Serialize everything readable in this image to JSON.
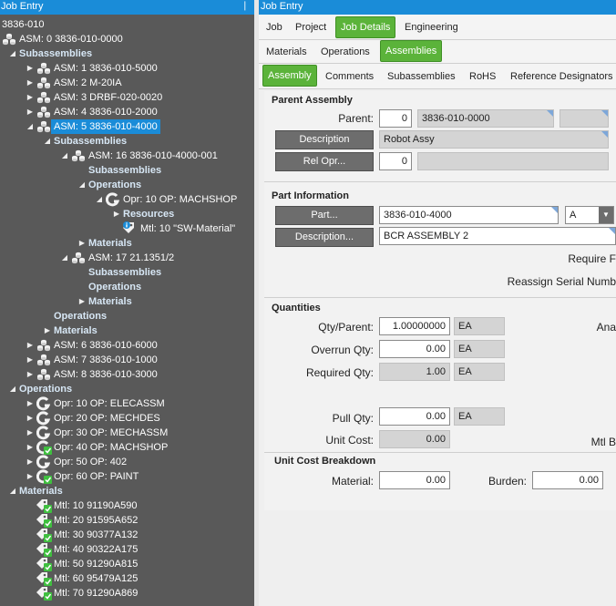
{
  "tree": {
    "title": "Job Entry",
    "pin_icon": "pin-icon",
    "rows": [
      {
        "text": "3836-010",
        "indent": 0,
        "arrow": "",
        "icon": "",
        "bold": false
      },
      {
        "text": "ASM: 0 3836-010-0000",
        "indent": 0,
        "arrow": "",
        "icon": "asm",
        "bold": false
      },
      {
        "text": "Subassemblies",
        "indent": 1,
        "arrow": "open",
        "icon": "",
        "bold": true
      },
      {
        "text": "ASM: 1 3836-010-5000",
        "indent": 2,
        "arrow": "closed",
        "icon": "asm",
        "bold": false
      },
      {
        "text": "ASM: 2 M-20IA",
        "indent": 2,
        "arrow": "closed",
        "icon": "asm",
        "bold": false
      },
      {
        "text": "ASM: 3 DRBF-020-0020",
        "indent": 2,
        "arrow": "closed",
        "icon": "asm",
        "bold": false
      },
      {
        "text": "ASM: 4 3836-010-2000",
        "indent": 2,
        "arrow": "closed",
        "icon": "asm",
        "bold": false
      },
      {
        "text": "ASM: 5 3836-010-4000",
        "indent": 2,
        "arrow": "open",
        "icon": "asm",
        "bold": false,
        "selected": true
      },
      {
        "text": "Subassemblies",
        "indent": 3,
        "arrow": "open",
        "icon": "",
        "bold": true
      },
      {
        "text": "ASM: 16 3836-010-4000-001",
        "indent": 4,
        "arrow": "open",
        "icon": "asm",
        "bold": false
      },
      {
        "text": "Subassemblies",
        "indent": 5,
        "arrow": "",
        "icon": "",
        "bold": true
      },
      {
        "text": "Operations",
        "indent": 5,
        "arrow": "open",
        "icon": "",
        "bold": true
      },
      {
        "text": "Opr: 10 OP: MACHSHOP",
        "indent": 6,
        "arrow": "open",
        "icon": "opr",
        "bold": false
      },
      {
        "text": "Resources",
        "indent": 7,
        "arrow": "closed",
        "icon": "",
        "bold": true
      },
      {
        "text": "Mtl: 10 \"SW-Material\"",
        "indent": 7,
        "arrow": "",
        "icon": "mtl-info",
        "bold": false
      },
      {
        "text": "Materials",
        "indent": 5,
        "arrow": "closed",
        "icon": "",
        "bold": true
      },
      {
        "text": "ASM: 17 21.1351/2",
        "indent": 4,
        "arrow": "open",
        "icon": "asm",
        "bold": false
      },
      {
        "text": "Subassemblies",
        "indent": 5,
        "arrow": "",
        "icon": "",
        "bold": true
      },
      {
        "text": "Operations",
        "indent": 5,
        "arrow": "",
        "icon": "",
        "bold": true
      },
      {
        "text": "Materials",
        "indent": 5,
        "arrow": "closed",
        "icon": "",
        "bold": true
      },
      {
        "text": "Operations",
        "indent": 3,
        "arrow": "",
        "icon": "",
        "bold": true
      },
      {
        "text": "Materials",
        "indent": 3,
        "arrow": "closed",
        "icon": "",
        "bold": true
      },
      {
        "text": "ASM: 6 3836-010-6000",
        "indent": 2,
        "arrow": "closed",
        "icon": "asm",
        "bold": false
      },
      {
        "text": "ASM: 7 3836-010-1000",
        "indent": 2,
        "arrow": "closed",
        "icon": "asm",
        "bold": false
      },
      {
        "text": "ASM: 8 3836-010-3000",
        "indent": 2,
        "arrow": "closed",
        "icon": "asm",
        "bold": false
      },
      {
        "text": "Operations",
        "indent": 1,
        "arrow": "open",
        "icon": "",
        "bold": true
      },
      {
        "text": "Opr: 10 OP: ELECASSM",
        "indent": 2,
        "arrow": "closed",
        "icon": "opr",
        "bold": false
      },
      {
        "text": "Opr: 20 OP: MECHDES",
        "indent": 2,
        "arrow": "closed",
        "icon": "opr",
        "bold": false
      },
      {
        "text": "Opr: 30 OP: MECHASSM",
        "indent": 2,
        "arrow": "closed",
        "icon": "opr",
        "bold": false
      },
      {
        "text": "Opr: 40 OP: MACHSHOP",
        "indent": 2,
        "arrow": "closed",
        "icon": "opr-check",
        "bold": false
      },
      {
        "text": "Opr: 50 OP: 402",
        "indent": 2,
        "arrow": "closed",
        "icon": "opr",
        "bold": false
      },
      {
        "text": "Opr: 60 OP: PAINT",
        "indent": 2,
        "arrow": "closed",
        "icon": "opr-check",
        "bold": false
      },
      {
        "text": "Materials",
        "indent": 1,
        "arrow": "open",
        "icon": "",
        "bold": true
      },
      {
        "text": "Mtl: 10 91190A590",
        "indent": 2,
        "arrow": "",
        "icon": "mtl-check",
        "bold": false
      },
      {
        "text": "Mtl: 20 91595A652",
        "indent": 2,
        "arrow": "",
        "icon": "mtl-check",
        "bold": false
      },
      {
        "text": "Mtl: 30 90377A132",
        "indent": 2,
        "arrow": "",
        "icon": "mtl-check",
        "bold": false
      },
      {
        "text": "Mtl: 40 90322A175",
        "indent": 2,
        "arrow": "",
        "icon": "mtl-check",
        "bold": false
      },
      {
        "text": "Mtl: 50 91290A815",
        "indent": 2,
        "arrow": "",
        "icon": "mtl-check",
        "bold": false
      },
      {
        "text": "Mtl: 60 95479A125",
        "indent": 2,
        "arrow": "",
        "icon": "mtl-check",
        "bold": false
      },
      {
        "text": "Mtl: 70 91290A869",
        "indent": 2,
        "arrow": "",
        "icon": "mtl-check",
        "bold": false
      }
    ]
  },
  "right": {
    "title": "Job Entry",
    "tabs1": [
      "Job",
      "Project",
      "Job Details",
      "Engineering"
    ],
    "tabs2": [
      "Materials",
      "Operations",
      "Assemblies"
    ],
    "tabs3": [
      "Assembly",
      "Comments",
      "Subassemblies",
      "RoHS",
      "Reference Designators"
    ],
    "parent": {
      "section": "Parent Assembly",
      "parent_label": "Parent:",
      "parent_seq": "0",
      "parent_part": "3836-010-0000",
      "description_btn": "Description",
      "description_value": "Robot Assy",
      "relopr_btn": "Rel Opr...",
      "relopr_value": "0"
    },
    "part": {
      "section": "Part Information",
      "part_btn": "Part...",
      "part_value": "3836-010-4000",
      "rev_value": "A",
      "desc_btn": "Description...",
      "desc_value": "BCR ASSEMBLY 2",
      "require_label": "Require F",
      "reassign_label": "Reassign Serial Numb"
    },
    "quantities": {
      "section": "Quantities",
      "qty_parent_label": "Qty/Parent:",
      "qty_parent_value": "1.00000000",
      "qty_parent_uom": "EA",
      "overrun_label": "Overrun Qty:",
      "overrun_value": "0.00",
      "overrun_uom": "EA",
      "required_label": "Required Qty:",
      "required_value": "1.00",
      "required_uom": "EA",
      "pull_label": "Pull Qty:",
      "pull_value": "0.00",
      "pull_uom": "EA",
      "unit_cost_label": "Unit Cost:",
      "unit_cost_value": "0.00",
      "ana_label": "Ana",
      "mtl_b_label": "Mtl B"
    },
    "ucb": {
      "section": "Unit Cost Breakdown",
      "material_label": "Material:",
      "material_value": "0.00",
      "burden_label": "Burden:",
      "burden_value": "0.00"
    }
  },
  "colors": {
    "accent_blue": "#1a8cd8",
    "tab_green": "#5bb33a",
    "tree_bg": "#595959",
    "check_green": "#3fbf3f"
  }
}
